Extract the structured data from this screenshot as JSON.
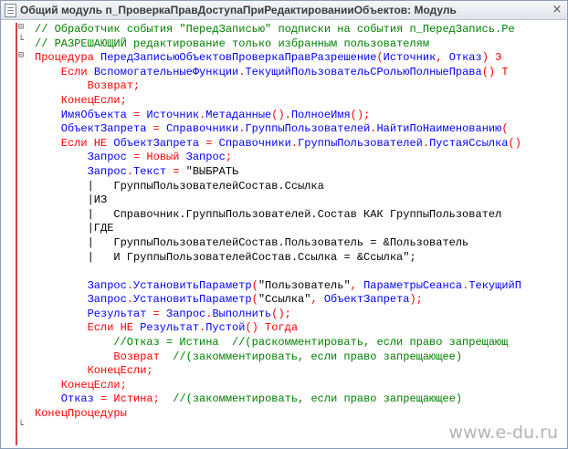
{
  "window": {
    "title": "Общий модуль п_ПроверкаПравДоступаПриРедактированииОбъектов: Модуль",
    "close_glyph": "×"
  },
  "watermark": "www.e-du.ru",
  "code": [
    {
      "indent": 0,
      "tokens": [
        [
          "c",
          "// Обработчик события \"ПередЗаписью\" подписки на события п_ПередЗапись.Ре"
        ]
      ]
    },
    {
      "indent": 0,
      "tokens": [
        [
          "c",
          "// РАЗРЕШАЮЩИЙ редактирование только избранным пользователям"
        ]
      ]
    },
    {
      "indent": 0,
      "tokens": [
        [
          "k",
          "Процедура "
        ],
        [
          "i",
          "ПередЗаписьюОбъектовПроверкаПравРазрешение"
        ],
        [
          "p",
          "("
        ],
        [
          "i",
          "Источник"
        ],
        [
          "p",
          ", "
        ],
        [
          "i",
          "Отказ"
        ],
        [
          "p",
          ") "
        ],
        [
          "k",
          "Э"
        ]
      ]
    },
    {
      "indent": 4,
      "tokens": [
        [
          "k",
          "Если "
        ],
        [
          "i",
          "ВспомогательныеФункции"
        ],
        [
          "p",
          "."
        ],
        [
          "i",
          "ТекущийПользовательСРольюПолныеПрава"
        ],
        [
          "p",
          "() "
        ],
        [
          "k",
          "Т"
        ]
      ]
    },
    {
      "indent": 8,
      "tokens": [
        [
          "k",
          "Возврат"
        ],
        [
          "p",
          ";"
        ]
      ]
    },
    {
      "indent": 4,
      "tokens": [
        [
          "k",
          "КонецЕсли"
        ],
        [
          "p",
          ";"
        ]
      ]
    },
    {
      "indent": 4,
      "tokens": [
        [
          "i",
          "ИмяОбъекта "
        ],
        [
          "p",
          "= "
        ],
        [
          "i",
          "Источник"
        ],
        [
          "p",
          "."
        ],
        [
          "i",
          "Метаданные"
        ],
        [
          "p",
          "()."
        ],
        [
          "i",
          "ПолноеИмя"
        ],
        [
          "p",
          "();"
        ]
      ]
    },
    {
      "indent": 4,
      "tokens": [
        [
          "i",
          "ОбъектЗапрета "
        ],
        [
          "p",
          "= "
        ],
        [
          "i",
          "Справочники"
        ],
        [
          "p",
          "."
        ],
        [
          "i",
          "ГруппыПользователей"
        ],
        [
          "p",
          "."
        ],
        [
          "i",
          "НайтиПоНаименованию"
        ],
        [
          "p",
          "("
        ]
      ]
    },
    {
      "indent": 4,
      "tokens": [
        [
          "k",
          "Если НЕ "
        ],
        [
          "i",
          "ОбъектЗапрета "
        ],
        [
          "p",
          "= "
        ],
        [
          "i",
          "Справочники"
        ],
        [
          "p",
          "."
        ],
        [
          "i",
          "ГруппыПользователей"
        ],
        [
          "p",
          "."
        ],
        [
          "i",
          "ПустаяСсылка"
        ],
        [
          "p",
          "()"
        ]
      ]
    },
    {
      "indent": 8,
      "tokens": [
        [
          "i",
          "Запрос "
        ],
        [
          "p",
          "= "
        ],
        [
          "k",
          "Новый "
        ],
        [
          "i",
          "Запрос"
        ],
        [
          "p",
          ";"
        ]
      ]
    },
    {
      "indent": 8,
      "tokens": [
        [
          "i",
          "Запрос"
        ],
        [
          "p",
          "."
        ],
        [
          "i",
          "Текст "
        ],
        [
          "p",
          "= "
        ],
        [
          "s",
          "\"ВЫБРАТЬ"
        ]
      ]
    },
    {
      "indent": 8,
      "tokens": [
        [
          "s",
          "|   ГруппыПользователейСостав.Ссылка"
        ]
      ]
    },
    {
      "indent": 8,
      "tokens": [
        [
          "s",
          "|ИЗ"
        ]
      ]
    },
    {
      "indent": 8,
      "tokens": [
        [
          "s",
          "|   Справочник.ГруппыПользователей.Состав КАК ГруппыПользовател"
        ]
      ]
    },
    {
      "indent": 8,
      "tokens": [
        [
          "s",
          "|ГДЕ"
        ]
      ]
    },
    {
      "indent": 8,
      "tokens": [
        [
          "s",
          "|   ГруппыПользователейСостав.Пользователь = &Пользователь"
        ]
      ]
    },
    {
      "indent": 8,
      "tokens": [
        [
          "s",
          "|   И ГруппыПользователейСостав.Ссылка = &Ссылка\";"
        ]
      ]
    },
    {
      "indent": 0,
      "tokens": []
    },
    {
      "indent": 8,
      "tokens": [
        [
          "i",
          "Запрос"
        ],
        [
          "p",
          "."
        ],
        [
          "i",
          "УстановитьПараметр"
        ],
        [
          "p",
          "("
        ],
        [
          "s",
          "\"Пользователь\""
        ],
        [
          "p",
          ", "
        ],
        [
          "i",
          "ПараметрыСеанса"
        ],
        [
          "p",
          "."
        ],
        [
          "i",
          "ТекущийП"
        ]
      ]
    },
    {
      "indent": 8,
      "tokens": [
        [
          "i",
          "Запрос"
        ],
        [
          "p",
          "."
        ],
        [
          "i",
          "УстановитьПараметр"
        ],
        [
          "p",
          "("
        ],
        [
          "s",
          "\"Ссылка\""
        ],
        [
          "p",
          ", "
        ],
        [
          "i",
          "ОбъектЗапрета"
        ],
        [
          "p",
          ");"
        ]
      ]
    },
    {
      "indent": 8,
      "tokens": [
        [
          "i",
          "Результат "
        ],
        [
          "p",
          "= "
        ],
        [
          "i",
          "Запрос"
        ],
        [
          "p",
          "."
        ],
        [
          "i",
          "Выполнить"
        ],
        [
          "p",
          "();"
        ]
      ]
    },
    {
      "indent": 8,
      "tokens": [
        [
          "k",
          "Если НЕ "
        ],
        [
          "i",
          "Результат"
        ],
        [
          "p",
          "."
        ],
        [
          "i",
          "Пустой"
        ],
        [
          "p",
          "() "
        ],
        [
          "k",
          "Тогда"
        ]
      ]
    },
    {
      "indent": 12,
      "tokens": [
        [
          "c",
          "//Отказ = Истина  //(раскомментировать, если право запрещающ"
        ]
      ]
    },
    {
      "indent": 12,
      "tokens": [
        [
          "k",
          "Возврат  "
        ],
        [
          "c",
          "//(закомментировать, если право запрещающее)"
        ]
      ]
    },
    {
      "indent": 8,
      "tokens": [
        [
          "k",
          "КонецЕсли"
        ],
        [
          "p",
          ";"
        ]
      ]
    },
    {
      "indent": 4,
      "tokens": [
        [
          "k",
          "КонецЕсли"
        ],
        [
          "p",
          ";"
        ]
      ]
    },
    {
      "indent": 4,
      "tokens": [
        [
          "i",
          "Отказ "
        ],
        [
          "p",
          "= "
        ],
        [
          "k",
          "Истина"
        ],
        [
          "p",
          ";  "
        ],
        [
          "c",
          "//(закомментировать, если право запрещающее)"
        ]
      ]
    },
    {
      "indent": 0,
      "tokens": [
        [
          "k",
          "КонецПроцедуры"
        ]
      ]
    }
  ]
}
